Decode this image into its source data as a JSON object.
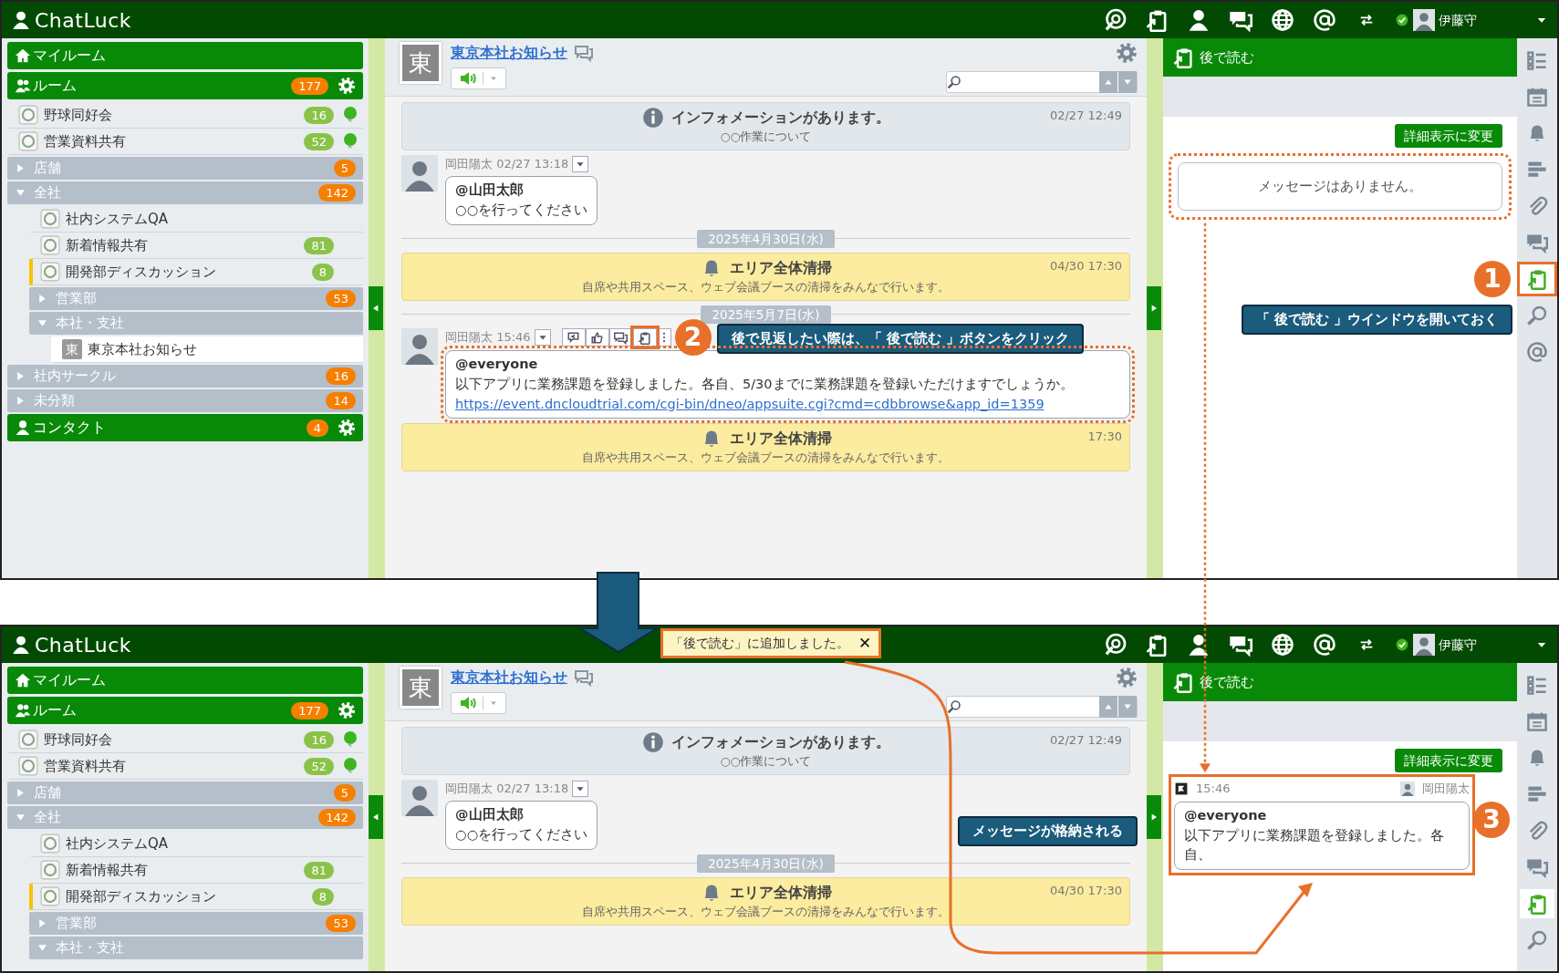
{
  "screens": [
    {
      "header": {
        "logo": "ChatLuck",
        "user": "伊藤守",
        "online": true
      },
      "sidebar": [
        {
          "kind": "home",
          "label": "マイルーム"
        },
        {
          "kind": "rooms",
          "label": "ルーム",
          "count": "177",
          "gear": true
        },
        {
          "kind": "room",
          "label": "野球同好会",
          "count": "16",
          "pinned": true,
          "marked": false,
          "selected": false
        },
        {
          "kind": "room",
          "label": "営業資料共有",
          "count": "52",
          "pinned": true,
          "marked": false,
          "selected": false
        },
        {
          "kind": "group",
          "label": "店舗",
          "count": "5",
          "expanded": false
        },
        {
          "kind": "group",
          "label": "全社",
          "count": "142",
          "expanded": true,
          "children": [
            {
              "kind": "room",
              "label": "社内システムQA",
              "pinned": false,
              "marked": false,
              "selected": false
            },
            {
              "kind": "room",
              "label": "新着情報共有",
              "count": "81",
              "pinned": false,
              "marked": false,
              "selected": false
            },
            {
              "kind": "room",
              "label": "開発部ディスカッション",
              "count": "8",
              "pinned": false,
              "marked": true,
              "selected": false
            },
            {
              "kind": "group",
              "label": "営業部",
              "count": "53",
              "expanded": false
            },
            {
              "kind": "group",
              "label": "本社・支社",
              "expanded": true,
              "children": [
                {
                  "kind": "room",
                  "label": "東京本社お知らせ",
                  "avatar": "東",
                  "pinned": false,
                  "marked": false,
                  "selected": true
                }
              ]
            }
          ]
        },
        {
          "kind": "group",
          "label": "社内サークル",
          "count": "16",
          "expanded": false
        },
        {
          "kind": "group",
          "label": "未分類",
          "count": "14",
          "expanded": false
        },
        {
          "kind": "contacts",
          "label": "コンタクト",
          "count": "4",
          "gear": true
        }
      ],
      "chat": {
        "avatar": "東",
        "title": "東京本社お知らせ",
        "sound_on": true,
        "messages": [
          {
            "kind": "info",
            "title": "インフォメーションがあります。",
            "text": "○○作業について",
            "time": "02/27 12:49"
          },
          {
            "kind": "post",
            "meta": "岡田陽太 02/27 13:18",
            "mention": "@山田太郎",
            "body": "○○を行ってください",
            "actions": false
          },
          {
            "kind": "date",
            "label": "2025年4月30日(水)"
          },
          {
            "kind": "notice",
            "title": "エリア全体清掃",
            "text": "自席や共用スペース、ウェブ会議ブースの清掃をみんなで行います。",
            "time": "04/30 17:30"
          },
          {
            "kind": "date",
            "label": "2025年5月7日(水)"
          },
          {
            "kind": "post",
            "meta": "岡田陽太 15:46",
            "mention": "@everyone",
            "body": "以下アプリに業務課題を登録しました。各自、5/30までに業務課題を登録いただけますでしょうか。",
            "link": "https://event.dncloudtrial.com/cgi-bin/dneo/appsuite.cgi?cmd=cdbbrowse&app_id=1359",
            "actions": true
          },
          {
            "kind": "notice",
            "title": "エリア全体清掃",
            "text": "自席や共用スペース、ウェブ会議ブースの清掃をみんなで行います。",
            "time": "17:30"
          }
        ]
      },
      "read_later": {
        "title": "後で読む",
        "button": "詳細表示に変更",
        "empty_text": "メッセージはありません。"
      },
      "toolbar": [
        {
          "kind": "tasks",
          "selected": false
        },
        {
          "kind": "calendar",
          "selected": false
        },
        {
          "kind": "bell",
          "selected": false
        },
        {
          "kind": "bars",
          "selected": false
        },
        {
          "kind": "clip",
          "selected": false
        },
        {
          "kind": "chat",
          "selected": false
        },
        {
          "kind": "readlater",
          "selected": true
        },
        {
          "kind": "search",
          "selected": false
        },
        {
          "kind": "at",
          "selected": false
        }
      ]
    },
    {
      "header": {
        "logo": "ChatLuck",
        "user": "伊藤守",
        "online": true
      },
      "sidebar": [
        {
          "kind": "home",
          "label": "マイルーム"
        },
        {
          "kind": "rooms",
          "label": "ルーム",
          "count": "177",
          "gear": true
        },
        {
          "kind": "room",
          "label": "野球同好会",
          "count": "16",
          "pinned": true,
          "marked": false,
          "selected": false
        },
        {
          "kind": "room",
          "label": "営業資料共有",
          "count": "52",
          "pinned": true,
          "marked": false,
          "selected": false
        },
        {
          "kind": "group",
          "label": "店舗",
          "count": "5",
          "expanded": false
        },
        {
          "kind": "group",
          "label": "全社",
          "count": "142",
          "expanded": true,
          "children": [
            {
              "kind": "room",
              "label": "社内システムQA",
              "pinned": false,
              "marked": false,
              "selected": false
            },
            {
              "kind": "room",
              "label": "新着情報共有",
              "count": "81",
              "pinned": false,
              "marked": false,
              "selected": false
            },
            {
              "kind": "room",
              "label": "開発部ディスカッション",
              "count": "8",
              "pinned": false,
              "marked": true,
              "selected": false
            },
            {
              "kind": "group",
              "label": "営業部",
              "count": "53",
              "expanded": false
            },
            {
              "kind": "group",
              "label": "本社・支社",
              "expanded": true
            }
          ]
        }
      ],
      "chat": {
        "avatar": "東",
        "title": "東京本社お知らせ",
        "sound_on": true,
        "messages": [
          {
            "kind": "info",
            "title": "インフォメーションがあります。",
            "text": "○○作業について",
            "time": "02/27 12:49"
          },
          {
            "kind": "post",
            "meta": "岡田陽太 02/27 13:18",
            "mention": "@山田太郎",
            "body": "○○を行ってください",
            "actions": false
          },
          {
            "kind": "date",
            "label": "2025年4月30日(水)"
          },
          {
            "kind": "notice",
            "title": "エリア全体清掃",
            "text": "自席や共用スペース、ウェブ会議ブースの清掃をみんなで行います。",
            "time": "04/30 17:30"
          }
        ]
      },
      "read_later": {
        "title": "後で読む",
        "button": "詳細表示に変更",
        "items": [
          {
            "time": "15:46",
            "author": "岡田陽太",
            "mention": "@everyone",
            "body": "以下アプリに業務課題を登録しました。各自、"
          }
        ]
      },
      "toolbar": [
        {
          "kind": "tasks",
          "selected": false
        },
        {
          "kind": "calendar",
          "selected": false
        },
        {
          "kind": "bell",
          "selected": false
        },
        {
          "kind": "bars",
          "selected": false
        },
        {
          "kind": "clip",
          "selected": false
        },
        {
          "kind": "chat",
          "selected": false
        },
        {
          "kind": "readlater",
          "selected": true
        },
        {
          "kind": "search",
          "selected": false
        }
      ]
    }
  ],
  "annotations": {
    "steps": [
      {
        "number": "1",
        "callout": "「 後で読む 」ウインドウを開いておく"
      },
      {
        "number": "2",
        "callout": "後で見返したい際は、「 後で読む 」ボタンをクリック"
      },
      {
        "number": "3",
        "callout": "メッセージが格納される"
      }
    ],
    "toast": {
      "text": "「後で読む」に追加しました。",
      "close": "✕"
    }
  }
}
